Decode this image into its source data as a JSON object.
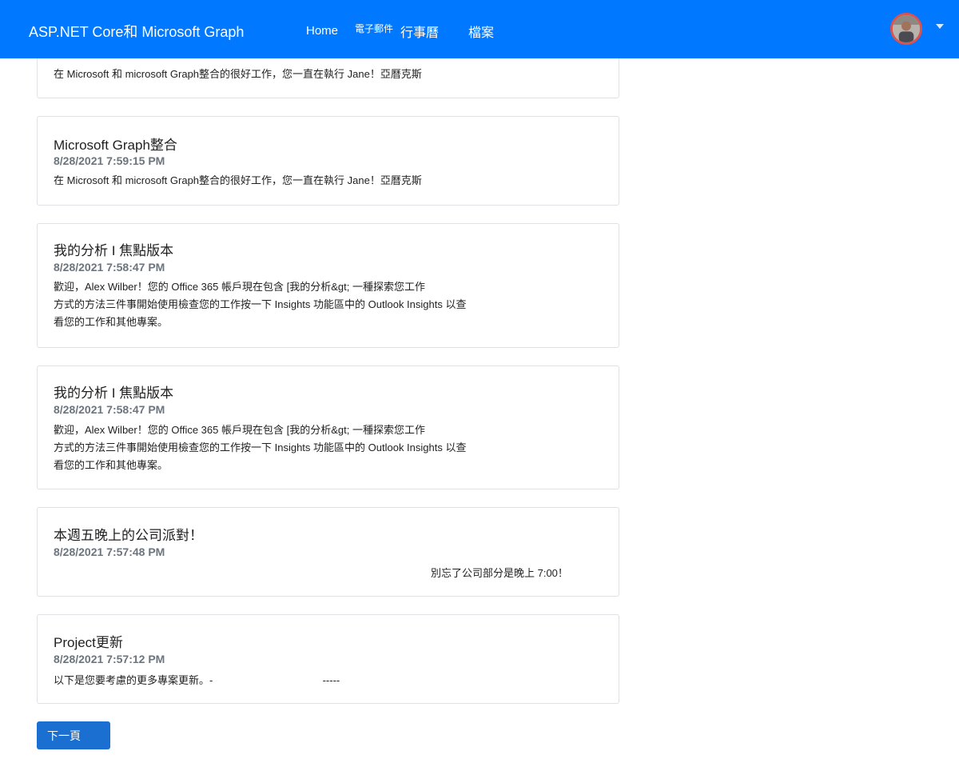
{
  "navbar": {
    "brand": "ASP.NET Core和 Microsoft Graph",
    "links": {
      "home": "Home",
      "mail": "電子郵件",
      "calendar": "行事曆",
      "files": "檔案"
    },
    "user_menu": {
      "avatar_icon": "user-avatar",
      "caret_icon": "chevron-down-icon"
    }
  },
  "messages": [
    {
      "title": "",
      "date": "",
      "body": [
        "在 Microsoft 和 microsoft Graph整合的很好工作，您一直在執行 Jane！亞曆克斯"
      ]
    },
    {
      "title": "Microsoft Graph整合",
      "date": "8/28/2021 7:59:15 PM",
      "body": [
        "在 Microsoft 和 microsoft Graph整合的很好工作，您一直在執行 Jane！亞曆克斯"
      ]
    },
    {
      "title": "我的分析 I 焦點版本",
      "date": "8/28/2021 7:58:47 PM",
      "body": [
        "歡迎，Alex Wilber！您的 Office 365 帳戶現在包含 [我的分析&gt; 一種探索您工作",
        "方式的方法三件事開始使用檢查您的工作按一下 Insights 功能區中的 Outlook Insights 以查",
        "看您的工作和其他專案。"
      ]
    },
    {
      "title": "我的分析 I 焦點版本",
      "date": "8/28/2021 7:58:47 PM",
      "body": [
        "歡迎，Alex Wilber！您的 Office 365 帳戶現在包含 [我的分析&gt; 一種探索您工作",
        "方式的方法三件事開始使用檢查您的工作按一下 Insights 功能區中的 Outlook Insights 以查",
        "看您的工作和其他專案。"
      ]
    },
    {
      "title": "本週五晚上的公司派對！",
      "date": "8/28/2021 7:57:48 PM",
      "body": [
        "別忘了公司部分是晚上 7:00！"
      ]
    },
    {
      "title": "Project更新",
      "date": "8/28/2021 7:57:12 PM",
      "body": [
        "以下是您要考慮的更多專案更新。-",
        "-----"
      ]
    }
  ],
  "pagination": {
    "next_label": "下一頁"
  }
}
